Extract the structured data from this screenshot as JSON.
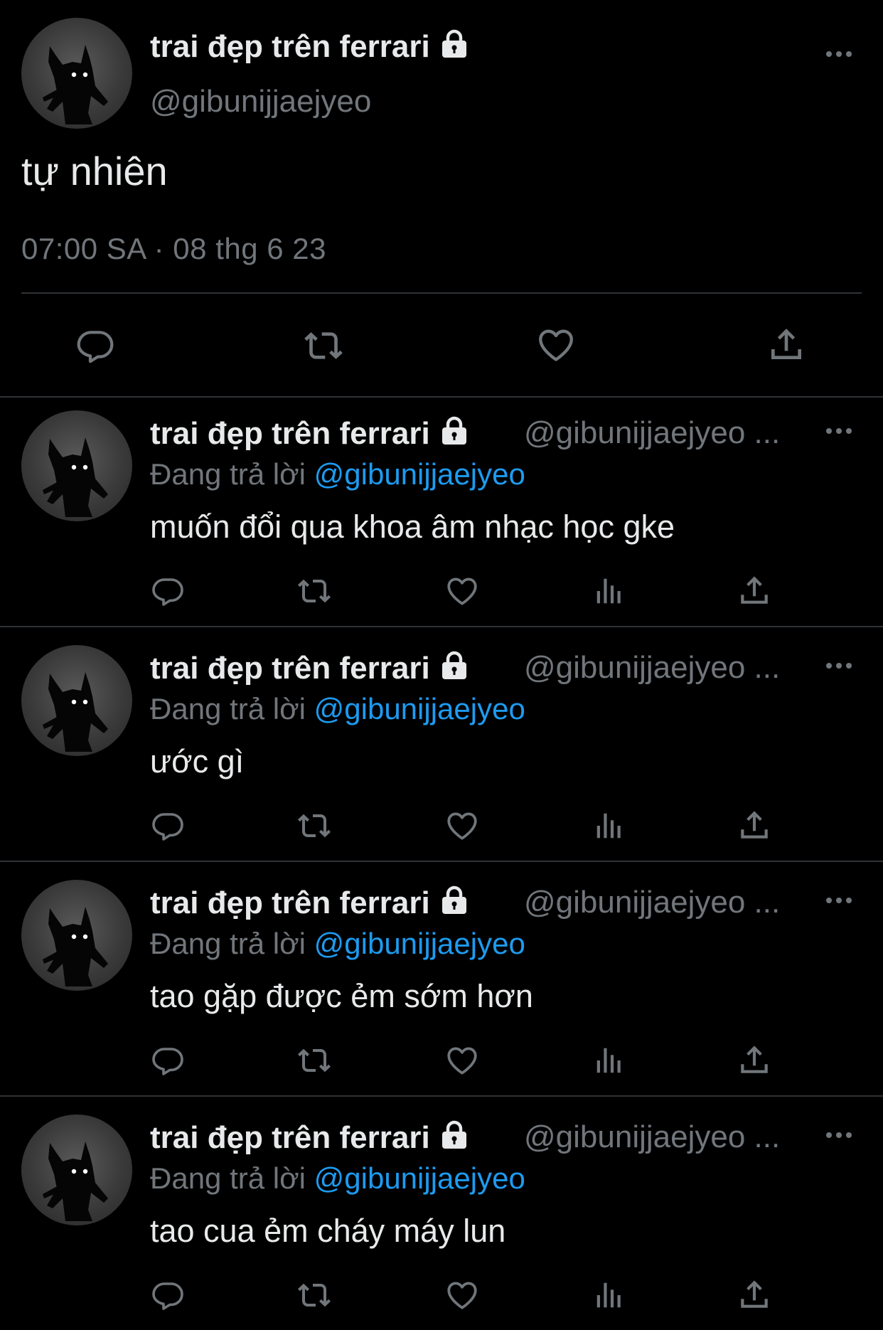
{
  "colors": {
    "background": "#000000",
    "text": "#e7e9ea",
    "muted": "#71767b",
    "link": "#1d9bf0",
    "divider": "#2f3336"
  },
  "main_tweet": {
    "name": "trai đẹp trên ferrari",
    "handle": "@gibunijjaejyeo",
    "text": "tự nhiên",
    "timestamp": "07:00 SA · 08 thg 6 23",
    "actions": [
      "reply-icon",
      "retweet-icon",
      "like-icon",
      "share-icon"
    ]
  },
  "replies": [
    {
      "name": "trai đẹp trên ferrari",
      "handle": "@gibunijjaejyeo ...",
      "replying_label": "Đang trả lời",
      "replying_to": "@gibunijjaejyeo",
      "text": "muốn đổi qua khoa âm nhạc học gke"
    },
    {
      "name": "trai đẹp trên ferrari",
      "handle": "@gibunijjaejyeo ...",
      "replying_label": "Đang trả lời",
      "replying_to": "@gibunijjaejyeo",
      "text": "ước gì"
    },
    {
      "name": "trai đẹp trên ferrari",
      "handle": "@gibunijjaejyeo ...",
      "replying_label": "Đang trả lời",
      "replying_to": "@gibunijjaejyeo",
      "text": "tao gặp được ẻm sớm hơn"
    },
    {
      "name": "trai đẹp trên ferrari",
      "handle": "@gibunijjaejyeo ...",
      "replying_label": "Đang trả lời",
      "replying_to": "@gibunijjaejyeo",
      "text": "tao cua ẻm cháy máy lun"
    }
  ],
  "reply_actions": [
    "reply-icon",
    "retweet-icon",
    "like-icon",
    "views-icon",
    "share-icon"
  ]
}
